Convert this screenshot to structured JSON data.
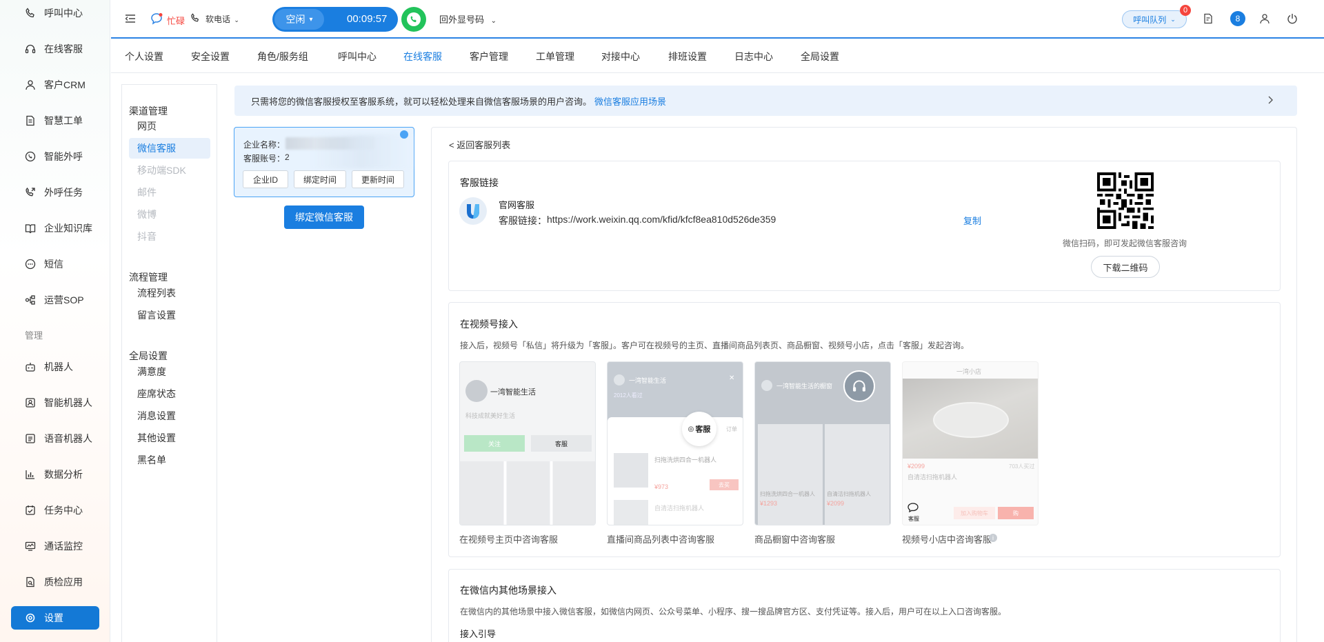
{
  "sidebar": {
    "items": [
      {
        "label": "呼叫中心",
        "icon": "phone-icon"
      },
      {
        "label": "在线客服",
        "icon": "headset-icon"
      },
      {
        "label": "客户CRM",
        "icon": "user-icon"
      },
      {
        "label": "智慧工单",
        "icon": "document-icon"
      },
      {
        "label": "智能外呼",
        "icon": "phone-circle-icon"
      },
      {
        "label": "外呼任务",
        "icon": "phone-out-icon"
      },
      {
        "label": "企业知识库",
        "icon": "book-icon"
      },
      {
        "label": "短信",
        "icon": "sms-icon"
      },
      {
        "label": "运营SOP",
        "icon": "flow-icon"
      }
    ],
    "section_label": "管理",
    "items2": [
      {
        "label": "机器人",
        "icon": "robot-icon"
      },
      {
        "label": "智能机器人",
        "icon": "smart-robot-icon"
      },
      {
        "label": "语音机器人",
        "icon": "voice-robot-icon"
      },
      {
        "label": "数据分析",
        "icon": "chart-icon"
      },
      {
        "label": "任务中心",
        "icon": "task-icon"
      },
      {
        "label": "通话监控",
        "icon": "monitor-icon"
      },
      {
        "label": "质检应用",
        "icon": "quality-icon"
      },
      {
        "label": "设置",
        "icon": "gear-icon"
      }
    ]
  },
  "header": {
    "status_busy": "忙碌",
    "softphone_label": "软电话",
    "call_status": "空闲",
    "timer": "00:09:57",
    "outbound_number_label": "回外显号码",
    "queue_label": "呼叫队列",
    "queue_badge": "0",
    "avatar_text": "8"
  },
  "nav": {
    "tabs": [
      "个人设置",
      "安全设置",
      "角色/服务组",
      "呼叫中心",
      "在线客服",
      "客户管理",
      "工单管理",
      "对接中心",
      "排班设置",
      "日志中心",
      "全局设置"
    ]
  },
  "menu": {
    "group1": "渠道管理",
    "group1_items": [
      "网页",
      "微信客服",
      "移动端SDK",
      "邮件",
      "微博",
      "抖音"
    ],
    "group2": "流程管理",
    "group2_items": [
      "流程列表",
      "留言设置"
    ],
    "group3": "全局设置",
    "group3_items": [
      "满意度",
      "座席状态",
      "消息设置",
      "其他设置",
      "黑名单"
    ]
  },
  "banner": {
    "text": "只需将您的微信客服授权至客服系统，就可以轻松处理来自微信客服场景的用户咨询。",
    "link": "微信客服应用场景"
  },
  "corp_card": {
    "corp_name_label": "企业名称：",
    "account_label": "客服账号：",
    "account_value": "2",
    "btn_corp_id": "企业ID",
    "btn_bind_time": "绑定时间",
    "btn_update_time": "更新时间"
  },
  "bind_button": "绑定微信客服",
  "back_link": "< 返回客服列表",
  "kf_link": {
    "title": "客服链接",
    "name": "官网客服",
    "link_label": "客服链接：",
    "url": "https://work.weixin.qq.com/kfid/kfcf8ea810d526de359",
    "copy": "复制",
    "qr_hint": "微信扫码，即可发起微信客服咨询",
    "download": "下载二维码"
  },
  "video": {
    "title": "在视频号接入",
    "desc": "接入后，视频号「私信」将升级为「客服」。客户可在视频号的主页、直播间商品列表页、商品橱窗、视频号小店，点击「客服」发起咨询。",
    "mock1": {
      "name": "一湾智能生活",
      "sub": "科技成就美好生活",
      "btn1": "关注",
      "btn2": "客服"
    },
    "mock2": {
      "name": "一湾智能生活",
      "viewers": "2012人看过",
      "kf": "客服",
      "sub": "订单",
      "p1": "扫拖洗烘四合一机器人",
      "p1_price": "¥973",
      "p1_btn": "去买",
      "p2": "自清洁扫拖机器人"
    },
    "mock3": {
      "name": "一湾智能生活的橱窗",
      "p1": "扫拖洗烘四合一机器人",
      "p1_price": "¥1293",
      "p2": "自清洁扫拖机器人",
      "p2_price": "¥2099"
    },
    "mock4": {
      "name": "一湾小店",
      "price": "¥2099",
      "sold": "703人买过",
      "desc": "自清洁扫拖机器人",
      "kf": "客服",
      "cart": "加入购物车",
      "buy": "购"
    },
    "captions": [
      "在视频号主页中咨询客服",
      "直播间商品列表中咨询客服",
      "商品橱窗中咨询客服",
      "视频号小店中咨询客服"
    ]
  },
  "other": {
    "title": "在微信内其他场景接入",
    "desc": "在微信内的其他场景中接入微信客服，如微信内网页、公众号菜单、小程序、搜一搜品牌官方区、支付凭证等。接入后，用户可在以上入口咨询客服。",
    "sub_title": "接入引导"
  },
  "colors": {
    "brand": "#1a7ee0",
    "accent_red": "#f5453d",
    "call_green": "#21c55e"
  }
}
